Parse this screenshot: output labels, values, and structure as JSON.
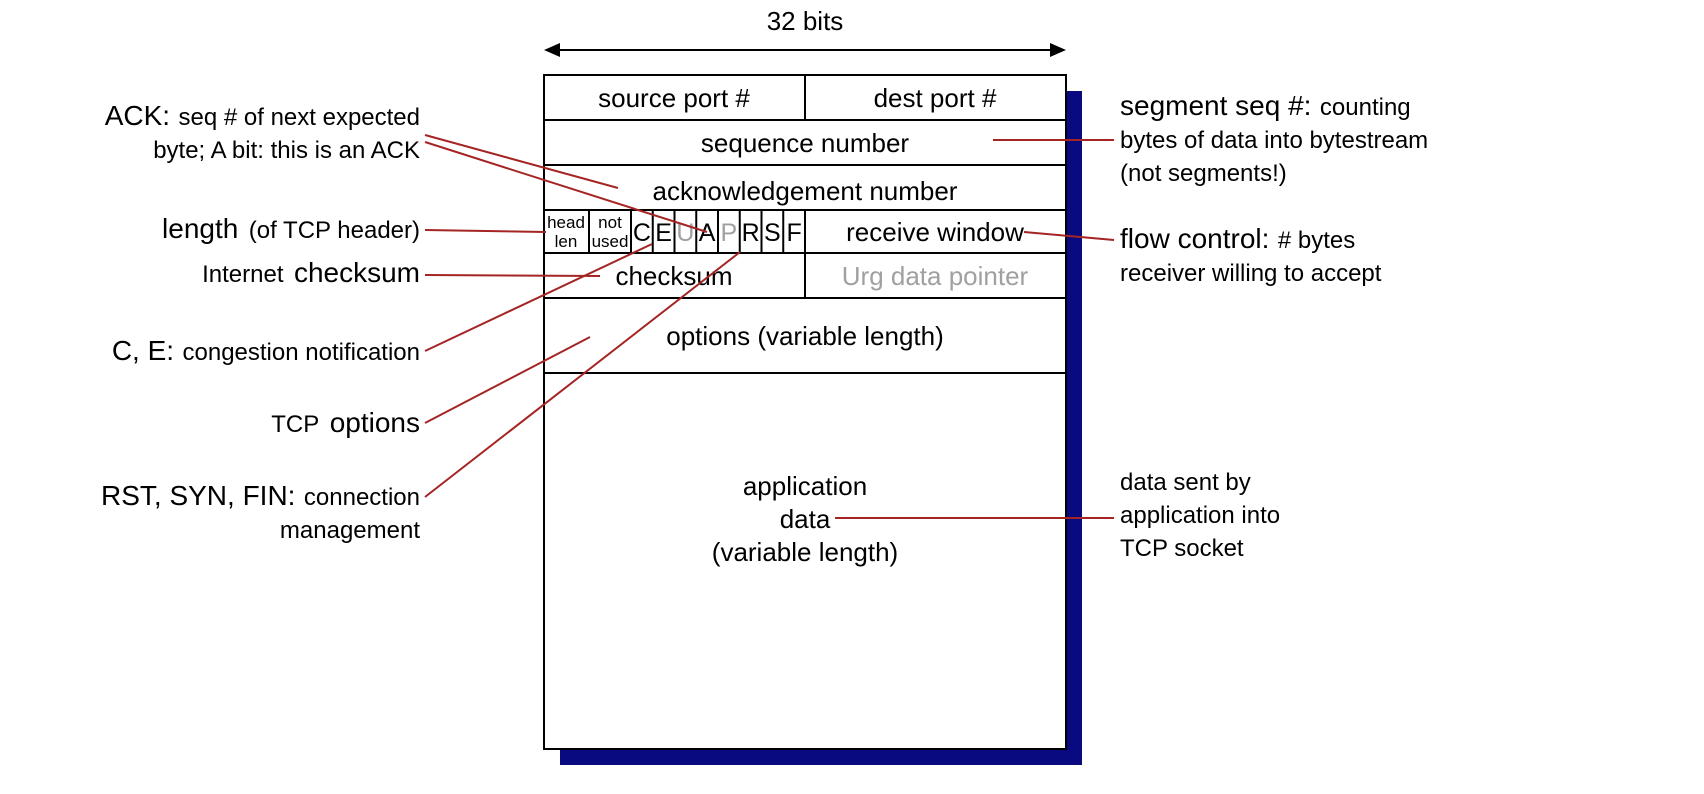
{
  "title": "32 bits",
  "header": {
    "source_port": "source port #",
    "dest_port": "dest port #",
    "seq_number": "sequence number",
    "ack_number": "acknowledgement number",
    "head_len_1": "head",
    "head_len_2": "len",
    "not_used_1": "not",
    "not_used_2": "used",
    "flags": {
      "C": "C",
      "E": "E",
      "U": "U",
      "A": "A",
      "P": "P",
      "R": "R",
      "S": "S",
      "F": "F"
    },
    "recv_window": "receive window",
    "checksum": "checksum",
    "urg_ptr": "Urg data pointer",
    "options": "options (variable length)",
    "app_data_1": "application",
    "app_data_2": "data",
    "app_data_3": "(variable length)"
  },
  "left_annotations": {
    "ack_bold": "ACK:",
    "ack_l1": "seq # of next expected",
    "ack_l2": "byte; A bit: this is an ACK",
    "len_bold": "length",
    "len_rest": "(of TCP header)",
    "cksum_pre": "Internet",
    "cksum_bold": "checksum",
    "ce_bold": "C, E:",
    "ce_rest": "congestion notification",
    "opt_pre": "TCP",
    "opt_bold": "options",
    "rsf_bold": "RST, SYN, FIN:",
    "rsf_rest": "connection",
    "rsf_l2": "management"
  },
  "right_annotations": {
    "seq_bold": "segment seq  #:",
    "seq_rest": "counting",
    "seq_l2": "bytes of data into bytestream",
    "seq_l3": "(not segments!)",
    "flow_bold": "flow control:",
    "flow_rest": "# bytes",
    "flow_l2": "receiver willing to accept",
    "data_l1": "data sent by",
    "data_l2": "application into",
    "data_l3": "TCP socket"
  }
}
